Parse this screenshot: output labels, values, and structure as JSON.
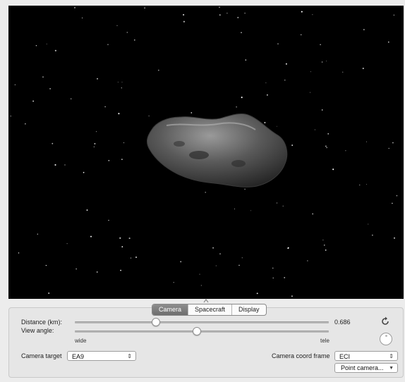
{
  "tabs": [
    {
      "label": "Camera",
      "active": true
    },
    {
      "label": "Spacecraft",
      "active": false
    },
    {
      "label": "Display",
      "active": false
    }
  ],
  "camera": {
    "distance_label": "Distance (km):",
    "distance_value": "0.686",
    "distance_slider_fraction": 0.32,
    "view_angle_label": "View angle:",
    "view_angle_slider_fraction": 0.48,
    "wide_label": "wide",
    "tele_label": "tele",
    "target_label": "Camera target",
    "target_value": "EA9",
    "coord_frame_label": "Camera coord frame",
    "coord_frame_value": "ECI",
    "point_camera_label": "Point camera...",
    "updown_arrow": "⇕",
    "down_arrow": "▼"
  },
  "icons": {
    "reset": "reset-icon",
    "dial": "orientation-dial-icon",
    "grip": "splitter-grip-icon"
  },
  "colors": {
    "space": "#000000",
    "active_tab": "#7a7a7a",
    "panel": "#e6e6e6"
  }
}
